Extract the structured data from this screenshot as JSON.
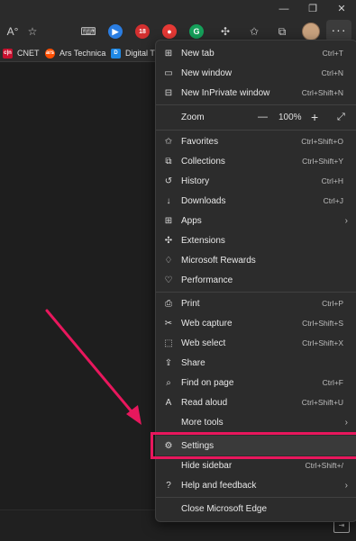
{
  "favorites_bar": {
    "items": [
      {
        "label": "CNET",
        "icon": "cnet-icon",
        "color": "#c8102e"
      },
      {
        "label": "Ars Technica",
        "icon": "ars-technica-icon",
        "color": "#ff4e00"
      },
      {
        "label": "Digital Tr",
        "icon": "digital-trends-icon",
        "color": "#1e88e5"
      }
    ]
  },
  "toolbar": {
    "extension_badge": "18",
    "more_button": "···"
  },
  "menu": {
    "items": [
      {
        "label": "New tab",
        "shortcut": "Ctrl+T",
        "icon": "new-tab-icon"
      },
      {
        "label": "New window",
        "shortcut": "Ctrl+N",
        "icon": "new-window-icon"
      },
      {
        "label": "New InPrivate window",
        "shortcut": "Ctrl+Shift+N",
        "icon": "inprivate-icon"
      },
      {
        "label": "Zoom",
        "icon": ""
      },
      {
        "label": "Favorites",
        "shortcut": "Ctrl+Shift+O",
        "icon": "favorites-icon"
      },
      {
        "label": "Collections",
        "shortcut": "Ctrl+Shift+Y",
        "icon": "collections-icon"
      },
      {
        "label": "History",
        "shortcut": "Ctrl+H",
        "icon": "history-icon"
      },
      {
        "label": "Downloads",
        "shortcut": "Ctrl+J",
        "icon": "downloads-icon"
      },
      {
        "label": "Apps",
        "shortcut": "",
        "icon": "apps-icon"
      },
      {
        "label": "Extensions",
        "shortcut": "",
        "icon": "extensions-icon"
      },
      {
        "label": "Microsoft Rewards",
        "shortcut": "",
        "icon": "rewards-icon"
      },
      {
        "label": "Performance",
        "shortcut": "",
        "icon": "performance-icon"
      },
      {
        "label": "Print",
        "shortcut": "Ctrl+P",
        "icon": "print-icon"
      },
      {
        "label": "Web capture",
        "shortcut": "Ctrl+Shift+S",
        "icon": "web-capture-icon"
      },
      {
        "label": "Web select",
        "shortcut": "Ctrl+Shift+X",
        "icon": "web-select-icon"
      },
      {
        "label": "Share",
        "shortcut": "",
        "icon": "share-icon"
      },
      {
        "label": "Find on page",
        "shortcut": "Ctrl+F",
        "icon": "find-icon"
      },
      {
        "label": "Read aloud",
        "shortcut": "Ctrl+Shift+U",
        "icon": "read-aloud-icon"
      },
      {
        "label": "More tools",
        "shortcut": "",
        "icon": ""
      },
      {
        "label": "Settings",
        "shortcut": "",
        "icon": "settings-icon"
      },
      {
        "label": "Hide sidebar",
        "shortcut": "Ctrl+Shift+/",
        "icon": ""
      },
      {
        "label": "Help and feedback",
        "shortcut": "",
        "icon": "help-icon"
      },
      {
        "label": "Close Microsoft Edge",
        "shortcut": "",
        "icon": ""
      }
    ],
    "zoom_minus": "—",
    "zoom_value": "100%",
    "zoom_plus": "+"
  },
  "colors": {
    "highlight": "#e8175d",
    "arrow": "#e8175d"
  }
}
